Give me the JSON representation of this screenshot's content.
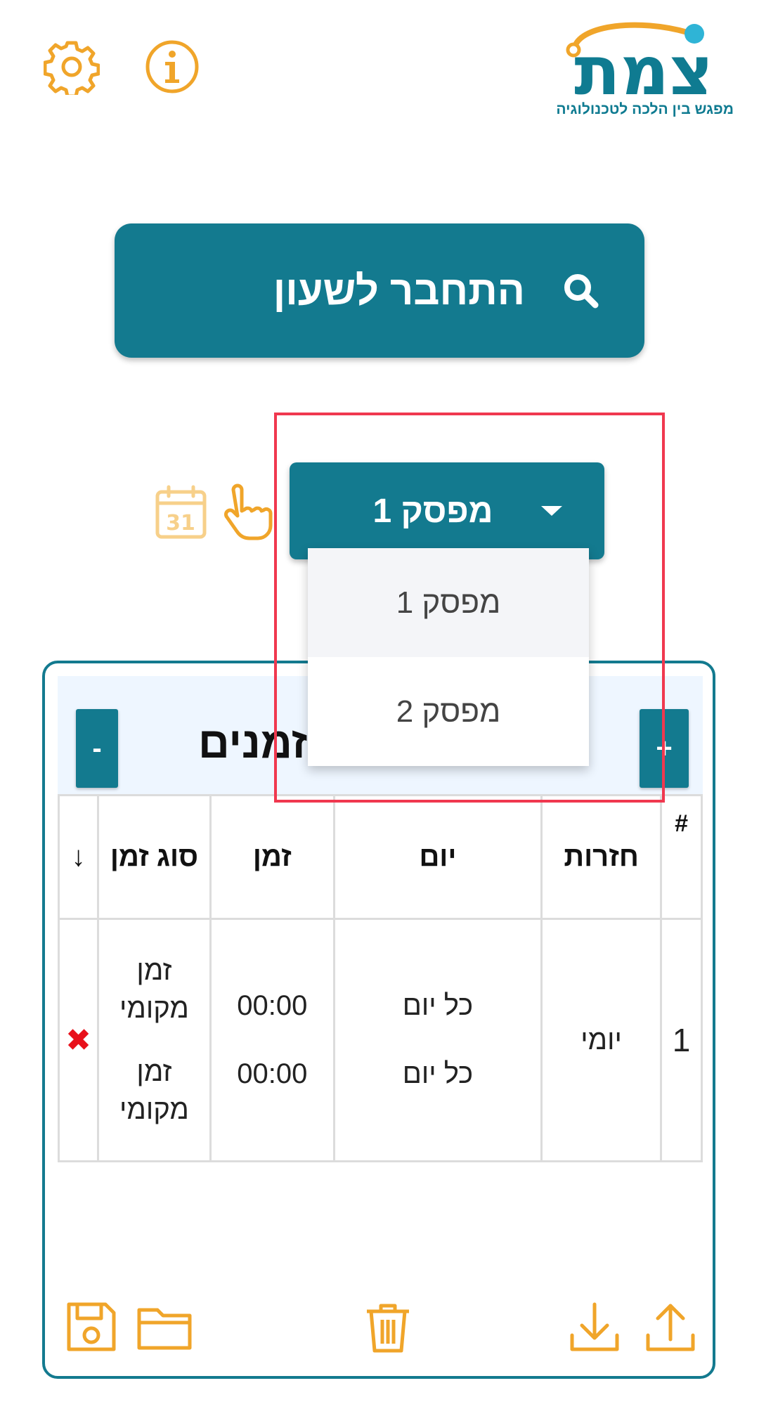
{
  "logo": {
    "text": "צמת",
    "subtitle": "מפגש בין הלכה לטכנולוגיה"
  },
  "header": {
    "settings_icon": "gear-icon",
    "info_icon": "info-icon"
  },
  "connect": {
    "label": "התחבר לשעון",
    "icon": "search-icon"
  },
  "selector": {
    "selected": "מפסק 1",
    "options": [
      "מפסק 1",
      "מפסק 2"
    ]
  },
  "schedule": {
    "title": "זמנים",
    "add_label": "+",
    "remove_label": "-",
    "columns": {
      "num": "#",
      "repeat": "חזרות",
      "day": "יום",
      "time": "זמן",
      "time_type": "סוג זמן",
      "sort": "↓"
    },
    "rows": [
      {
        "num": "1",
        "repeat": "יומי",
        "days": [
          "כל יום",
          "כל יום"
        ],
        "times": [
          "00:00",
          "00:00"
        ],
        "time_types": [
          "זמן מקומי",
          "זמן מקומי"
        ],
        "delete": "✖"
      }
    ]
  },
  "colors": {
    "primary": "#137a8f",
    "accent": "#f0a52a",
    "highlight": "#f0384f"
  }
}
